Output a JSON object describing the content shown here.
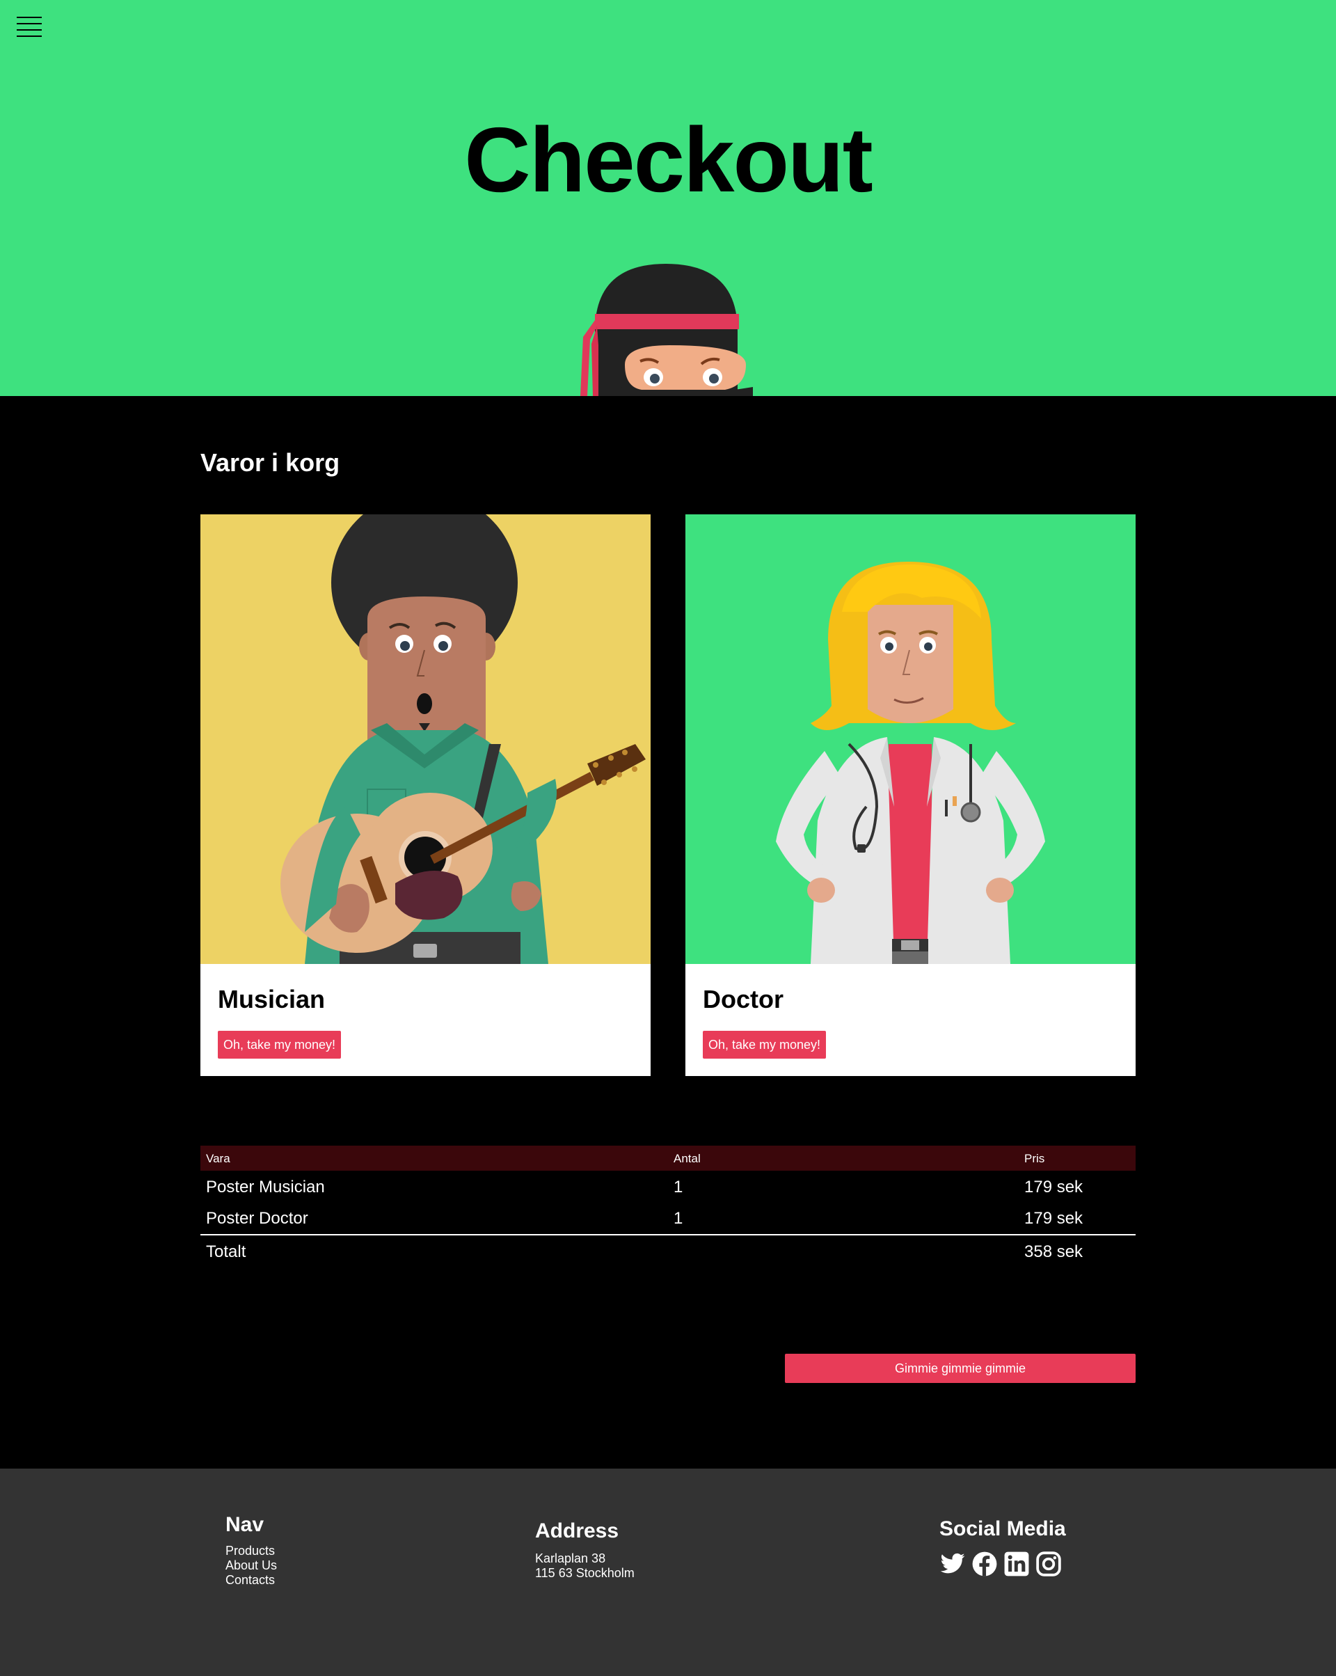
{
  "header": {
    "menu_icon": "hamburger-menu-icon",
    "title": "Checkout",
    "background": "#3ee17f"
  },
  "cart": {
    "heading": "Varor i korg",
    "products": [
      {
        "name": "Musician",
        "button_label": "Oh, take my money!",
        "image_bg": "#edd264"
      },
      {
        "name": "Doctor",
        "button_label": "Oh, take my money!",
        "image_bg": "#3ee17f"
      }
    ]
  },
  "table": {
    "headers": {
      "vara": "Vara",
      "antal": "Antal",
      "pris": "Pris"
    },
    "rows": [
      {
        "vara": "Poster Musician",
        "antal": "1",
        "pris": "179 sek"
      },
      {
        "vara": "Poster Doctor",
        "antal": "1",
        "pris": "179 sek"
      }
    ],
    "total": {
      "label": "Totalt",
      "pris": "358 sek"
    }
  },
  "checkout_button": "Gimmie gimmie gimmie",
  "footer": {
    "nav": {
      "heading": "Nav",
      "links": [
        "Products",
        "About Us",
        "Contacts"
      ]
    },
    "address": {
      "heading": "Address",
      "line1": "Karlaplan 38",
      "line2": "115 63 Stockholm"
    },
    "social": {
      "heading": "Social Media",
      "icons": [
        "twitter-icon",
        "facebook-icon",
        "linkedin-icon",
        "instagram-icon"
      ]
    }
  },
  "colors": {
    "accent": "#e83c58",
    "table_header": "#3b070b",
    "footer_bg": "#333333"
  }
}
